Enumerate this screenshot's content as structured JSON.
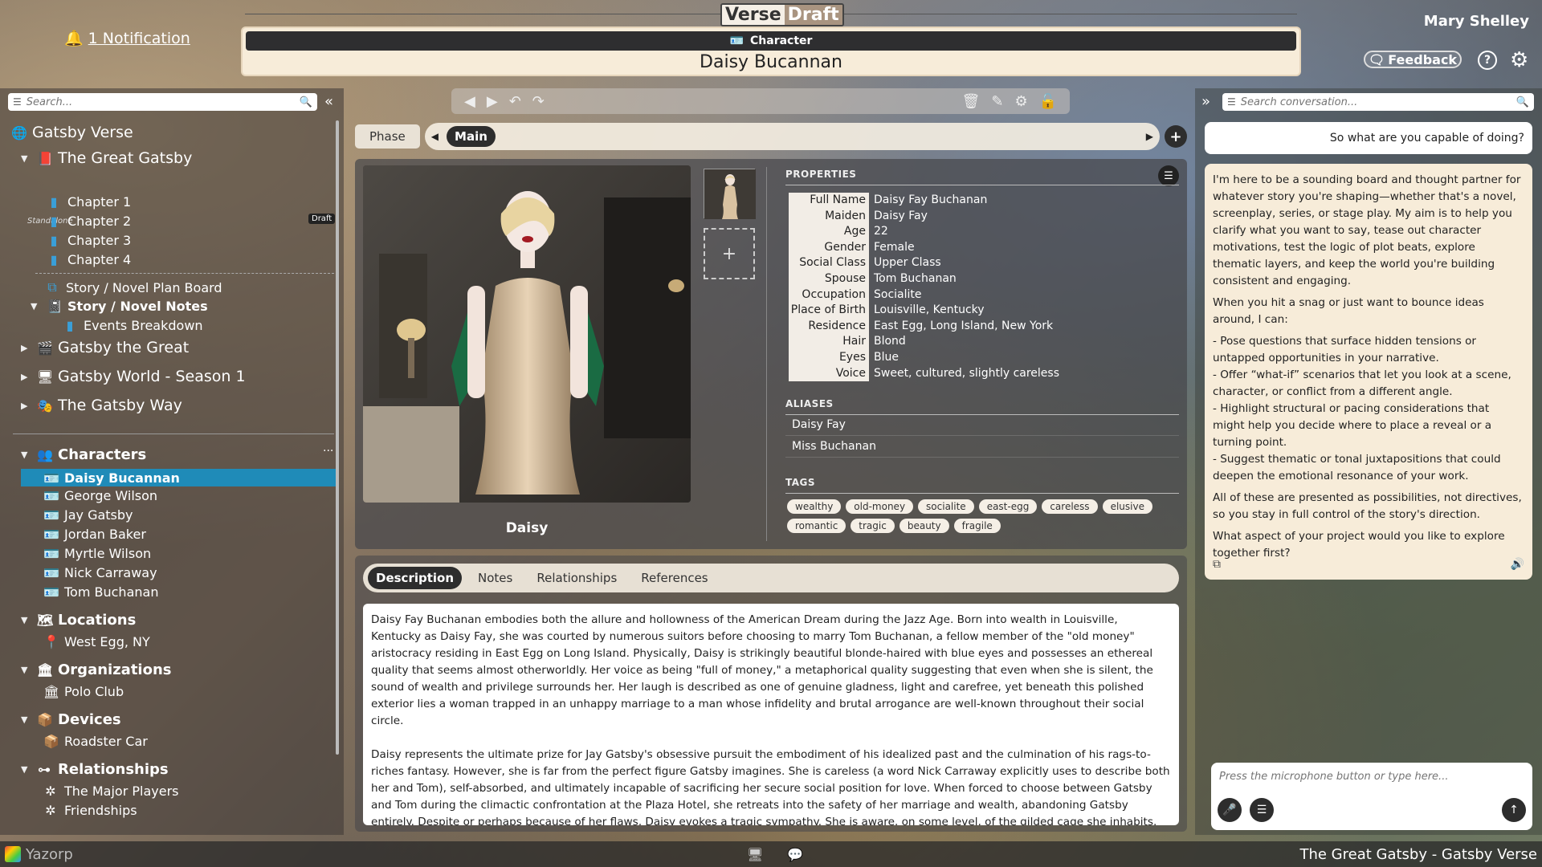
{
  "header": {
    "notification": "1 Notification",
    "brand_verse": "Verse",
    "brand_draft": "Draft",
    "type_label": "Character",
    "page_title": "Daisy Bucannan",
    "user_name": "Mary Shelley",
    "feedback_label": "Feedback",
    "help_label": "?"
  },
  "sidebar": {
    "search_placeholder": "Search...",
    "verse": "Gatsby Verse",
    "project1": "The Great Gatsby",
    "standalone": "Standalone",
    "draft_badge": "Draft",
    "chapters": [
      "Chapter 1",
      "Chapter 2",
      "Chapter 3",
      "Chapter 4"
    ],
    "plan_board": "Story / Novel Plan Board",
    "notes": "Story / Novel Notes",
    "events": "Events Breakdown",
    "project2": "Gatsby the Great",
    "project3": "Gatsby World - Season 1",
    "project4": "The Gatsby Way",
    "characters_title": "Characters",
    "characters": [
      "Daisy Bucannan",
      "George Wilson",
      "Jay Gatsby",
      "Jordan Baker",
      "Myrtle Wilson",
      "Nick Carraway",
      "Tom Buchanan"
    ],
    "locations_title": "Locations",
    "locations": [
      "West Egg, NY"
    ],
    "organizations_title": "Organizations",
    "organizations": [
      "Polo Club"
    ],
    "devices_title": "Devices",
    "devices": [
      "Roadster Car"
    ],
    "relationships_title": "Relationships",
    "relationships": [
      "The Major Players",
      "Friendships"
    ]
  },
  "phase": {
    "label": "Phase",
    "current": "Main"
  },
  "character": {
    "caption": "Daisy",
    "properties_title": "PROPERTIES",
    "properties": [
      {
        "k": "Full Name",
        "v": "Daisy Fay Buchanan"
      },
      {
        "k": "Maiden Name",
        "v": "Daisy Fay"
      },
      {
        "k": "Age",
        "v": "22"
      },
      {
        "k": "Gender",
        "v": "Female"
      },
      {
        "k": "Social Class",
        "v": "Upper Class"
      },
      {
        "k": "Spouse",
        "v": "Tom Buchanan"
      },
      {
        "k": "Occupation",
        "v": "Socialite"
      },
      {
        "k": "Place of Birth",
        "v": "Louisville, Kentucky"
      },
      {
        "k": "Residence",
        "v": "East Egg, Long Island, New York"
      },
      {
        "k": "Hair",
        "v": "Blond"
      },
      {
        "k": "Eyes",
        "v": "Blue"
      },
      {
        "k": "Voice",
        "v": "Sweet, cultured, slightly careless"
      }
    ],
    "aliases_title": "ALIASES",
    "aliases": [
      "Daisy Fay",
      "Miss Buchanan"
    ],
    "tags_title": "TAGS",
    "tags": [
      "wealthy",
      "old-money",
      "socialite",
      "east-egg",
      "careless",
      "elusive",
      "romantic",
      "tragic",
      "beauty",
      "fragile"
    ]
  },
  "tabs": [
    "Description",
    "Notes",
    "Relationships",
    "References"
  ],
  "description": [
    "Daisy Fay Buchanan embodies both the allure and hollowness of the American Dream during the Jazz Age. Born into wealth in Louisville, Kentucky as Daisy Fay, she was courted by numerous suitors before choosing to marry Tom Buchanan, a fellow member of the \"old money\" aristocracy residing in East Egg on Long Island. Physically, Daisy is strikingly beautiful blonde-haired with blue eyes and possesses an ethereal quality that seems almost otherworldly. Her voice as being \"full of money,\" a metaphorical quality suggesting that even when she is silent, the sound of wealth and privilege surrounds her. Her laugh is described as one of genuine gladness, light and carefree, yet beneath this polished exterior lies a woman trapped in an unhappy marriage to a man whose infidelity and brutal arrogance are well-known throughout their social circle.",
    "Daisy represents the ultimate prize for Jay Gatsby's obsessive pursuit the embodiment of his idealized past and the culmination of his rags-to-riches fantasy. However, she is far from the perfect figure Gatsby imagines. She is careless (a word Nick Carraway explicitly uses to describe both her and Tom), self-absorbed, and ultimately incapable of sacrificing her secure social position for love. When forced to choose between Gatsby and Tom during the climactic confrontation at the Plaza Hotel, she retreats into the safety of her marriage and wealth, abandoning Gatsby entirely. Despite or perhaps because of her flaws, Daisy evokes a tragic sympathy. She is aware, on some level, of the gilded cage she inhabits. Her famous wish for her daughter to"
  ],
  "chat": {
    "search_placeholder": "Search conversation...",
    "user_message": "So what are you capable of doing?",
    "bot_paragraphs": [
      "I'm here to be a sounding board and thought partner for whatever story you're shaping—whether that's a novel, screenplay, series, or stage play. My aim is to help you clarify what you want to say, tease out character motivations, test the logic of plot beats, explore thematic layers, and keep the world you're building consistent and engaging.",
      "When you hit a snag or just want to bounce ideas around, I can:",
      "- Pose questions that surface hidden tensions or untapped opportunities in your narrative.\n- Offer “what-if” scenarios that let you look at a scene, character, or conflict from a different angle.\n- Highlight structural or pacing considerations that might help you decide where to place a reveal or a turning point.\n- Suggest thematic or tonal juxtapositions that could deepen the emotional resonance of your work.",
      "All of these are presented as possibilities, not directives, so you stay in full control of the story's direction.",
      "What aspect of your project would you like to explore together first?"
    ],
    "composer_placeholder": "Press the microphone button or type here..."
  },
  "statusbar": {
    "app_name": "Yazorp",
    "right_text": "The Great Gatsby - Gatsby Verse"
  }
}
